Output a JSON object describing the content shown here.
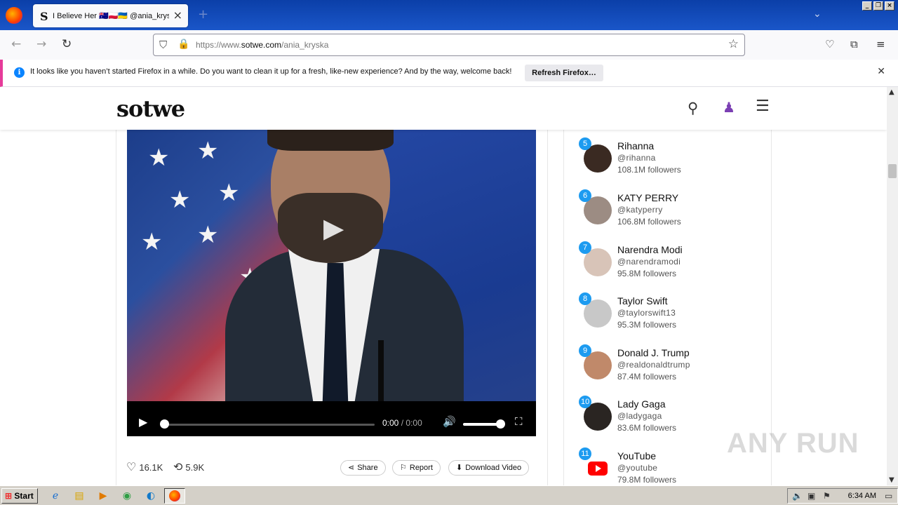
{
  "browser": {
    "tab_title": "I Believe Her 🇦🇺🇵🇱🇺🇦 @ania_kryska",
    "tab_favicon": "S",
    "url_prefix": "https://www.",
    "url_domain": "sotwe.com",
    "url_path": "/ania_kryska"
  },
  "notification": {
    "text": "It looks like you haven’t started Firefox in a while. Do you want to clean it up for a fresh, like-new experience? And by the way, welcome back!",
    "button_label": "Refresh Firefox…"
  },
  "site": {
    "logo": "sotwe"
  },
  "video": {
    "current_time": "0:00",
    "separator": "/",
    "duration": "0:00"
  },
  "tweet_actions": {
    "likes": "16.1K",
    "retweets": "5.9K",
    "share_label": "Share",
    "report_label": "Report",
    "download_label": "Download Video"
  },
  "accounts": [
    {
      "rank": "5",
      "name": "Rihanna",
      "handle": "@rihanna",
      "followers": "108.1M followers"
    },
    {
      "rank": "6",
      "name": "KATY PERRY",
      "handle": "@katyperry",
      "followers": "106.8M followers"
    },
    {
      "rank": "7",
      "name": "Narendra Modi",
      "handle": "@narendramodi",
      "followers": "95.8M followers"
    },
    {
      "rank": "8",
      "name": "Taylor Swift",
      "handle": "@taylorswift13",
      "followers": "95.3M followers"
    },
    {
      "rank": "9",
      "name": "Donald J. Trump",
      "handle": "@realdonaldtrump",
      "followers": "87.4M followers"
    },
    {
      "rank": "10",
      "name": "Lady Gaga",
      "handle": "@ladygaga",
      "followers": "83.6M followers"
    },
    {
      "rank": "11",
      "name": "YouTube",
      "handle": "@youtube",
      "followers": "79.8M followers"
    }
  ],
  "watermark": "ANY RUN",
  "taskbar": {
    "start_label": "Start",
    "clock": "6:34 AM"
  },
  "colors": {
    "rank_badge": "#1d9bf0",
    "notif_accent": "#e63b9a",
    "titlebar": "#1a56c9"
  }
}
